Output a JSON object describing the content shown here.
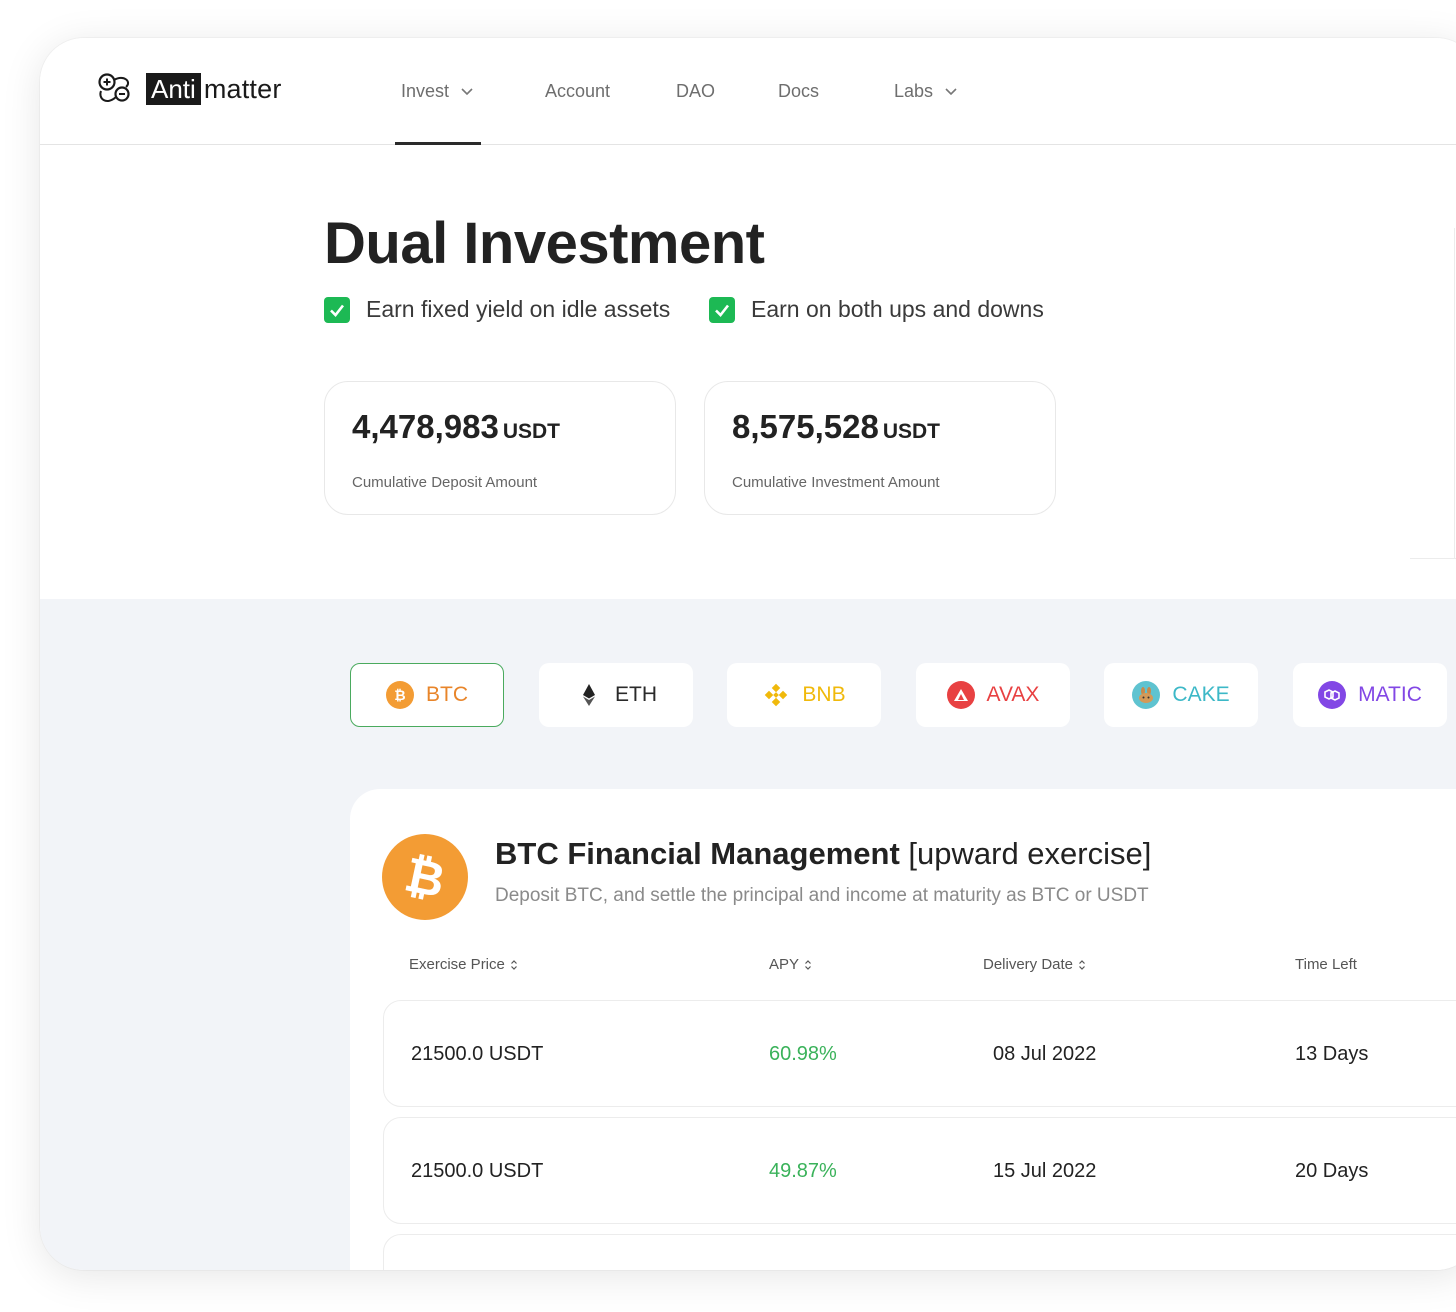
{
  "brand": {
    "anti": "Anti",
    "matter": "matter"
  },
  "nav": [
    {
      "label": "Invest",
      "dropdown": true,
      "active": true
    },
    {
      "label": "Account",
      "dropdown": false
    },
    {
      "label": "DAO",
      "dropdown": false
    },
    {
      "label": "Docs",
      "dropdown": false
    },
    {
      "label": "Labs",
      "dropdown": true
    }
  ],
  "hero": {
    "title": "Dual Investment",
    "features": [
      "Earn fixed yield on idle assets",
      "Earn on both ups and downs"
    ],
    "stats": [
      {
        "value": "4,478,983",
        "unit": "USDT",
        "label": "Cumulative Deposit Amount"
      },
      {
        "value": "8,575,528",
        "unit": "USDT",
        "label": "Cumulative Investment Amount"
      }
    ]
  },
  "tokens": [
    {
      "label": "BTC",
      "color": "#e8852a",
      "icon": "bitcoin-icon",
      "active": true
    },
    {
      "label": "ETH",
      "color": "#2a2a2a",
      "icon": "ethereum-icon"
    },
    {
      "label": "BNB",
      "color": "#f0b90b",
      "icon": "binance-icon"
    },
    {
      "label": "AVAX",
      "color": "#e84142",
      "icon": "avalanche-icon"
    },
    {
      "label": "CAKE",
      "color": "#3cb8c7",
      "icon": "pancakeswap-icon"
    },
    {
      "label": "MATIC",
      "color": "#8247e5",
      "icon": "polygon-icon"
    }
  ],
  "panel": {
    "title_bold": "BTC Financial Management",
    "title_rest": " [upward exercise]",
    "subtitle": "Deposit BTC, and settle the principal and income at maturity as BTC or USDT",
    "columns": [
      "Exercise Price",
      "APY",
      "Delivery Date",
      "Time Left"
    ],
    "rows": [
      {
        "price": "21500.0 USDT",
        "apy": "60.98%",
        "date": "08 Jul 2022",
        "left": "13 Days"
      },
      {
        "price": "21500.0 USDT",
        "apy": "49.87%",
        "date": "15 Jul 2022",
        "left": "20 Days"
      }
    ]
  },
  "colors": {
    "accent_green": "#3ab25a",
    "btc_orange": "#f39c34"
  }
}
